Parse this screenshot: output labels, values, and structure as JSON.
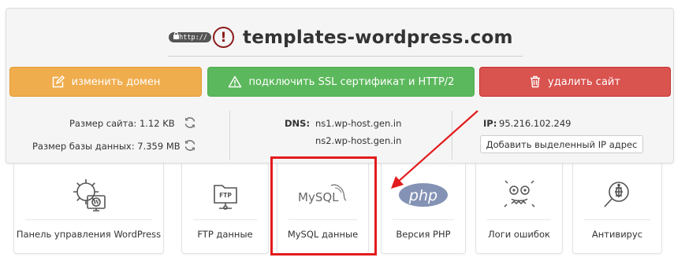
{
  "domain": {
    "url_badge": "http://",
    "warning_glyph": "!",
    "name": "templates-wordpress.com"
  },
  "buttons": {
    "change_domain": "изменить домен",
    "ssl": "подключить SSL сертификат и HTTP/2",
    "delete": "удалить сайт"
  },
  "stats": {
    "site_size_label": "Размер сайта:",
    "site_size_value": "1.12 KB",
    "db_size_label": "Размер базы данных:",
    "db_size_value": "7.359 MB"
  },
  "dns": {
    "label": "DNS:",
    "ns1": "ns1.wp-host.gen.in",
    "ns2": "ns2.wp-host.gen.in"
  },
  "ip": {
    "label": "IP:",
    "value": "95.216.102.249",
    "add_button": "Добавить выделенный IP адрес"
  },
  "tiles": [
    {
      "label": "Панель управления WordPress",
      "icon": "wordpress-gear-icon"
    },
    {
      "label": "FTP данные",
      "icon": "ftp-folder-icon",
      "icon_text": "FTP"
    },
    {
      "label": "MySQL данные",
      "icon": "mysql-logo-icon",
      "icon_text": "MySQL"
    },
    {
      "label": "Версия PHP",
      "icon": "php-logo-icon",
      "icon_text": "php"
    },
    {
      "label": "Логи ошибок",
      "icon": "error-bug-icon"
    },
    {
      "label": "Антивирус",
      "icon": "antivirus-icon"
    }
  ],
  "colors": {
    "orange": "#f0ad4e",
    "green": "#5cb85c",
    "red": "#d9534f",
    "highlight": "#e31b1b"
  }
}
